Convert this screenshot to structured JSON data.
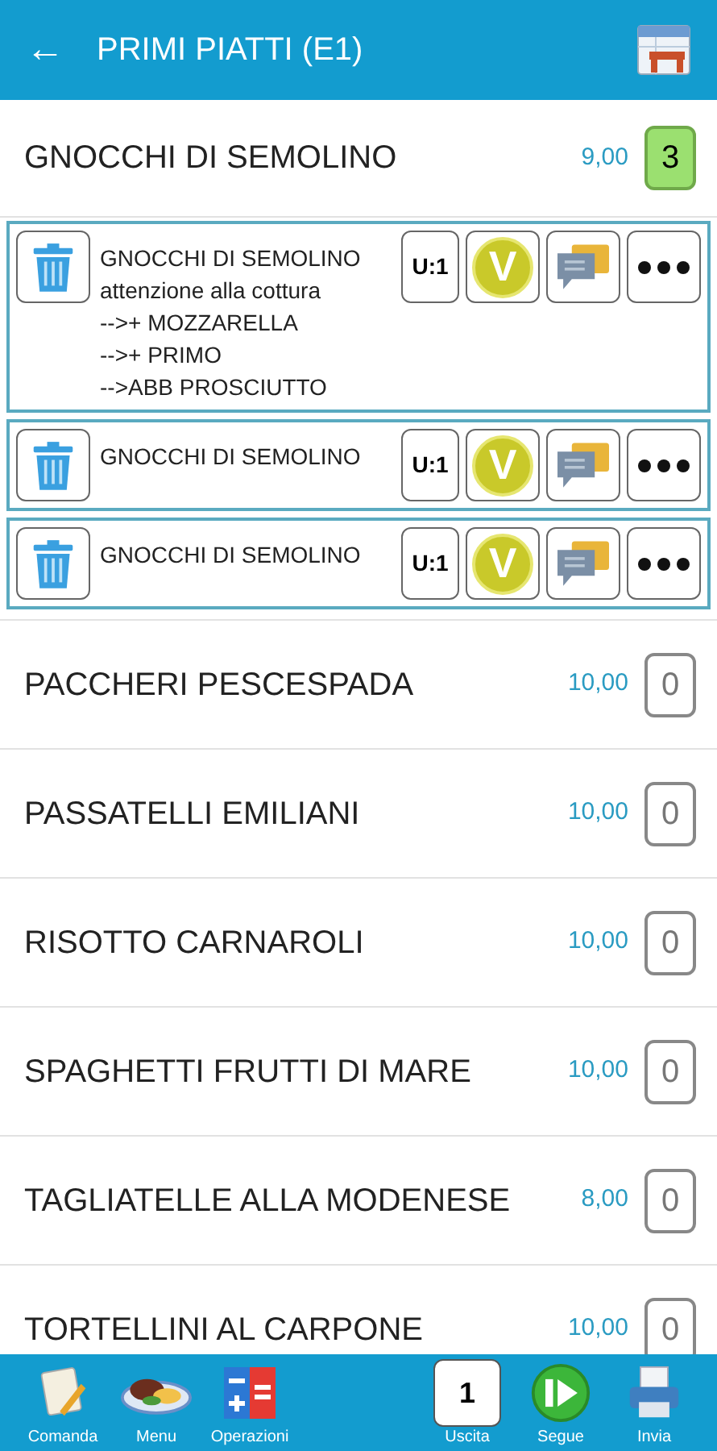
{
  "app_bar": {
    "back": "←",
    "title": "PRIMI PIATTI (E1)"
  },
  "expanded_item": {
    "name": "GNOCCHI DI SEMOLINO",
    "price": "9,00",
    "quantity": "3",
    "highlighted": true,
    "order_lines": [
      {
        "name": "GNOCCHI DI SEMOLINO",
        "notes": [
          "attenzione alla cottura",
          "-->+ MOZZARELLA",
          "-->+ PRIMO",
          "-->ABB PROSCIUTTO"
        ],
        "unit": "U:1",
        "mark": "V"
      },
      {
        "name": "GNOCCHI DI SEMOLINO",
        "unit": "U:1",
        "mark": "V"
      },
      {
        "name": "GNOCCHI DI SEMOLINO",
        "unit": "U:1",
        "mark": "V"
      }
    ]
  },
  "items": [
    {
      "name": "PACCHERI PESCESPADA",
      "price": "10,00",
      "quantity": "0",
      "highlighted": false
    },
    {
      "name": "PASSATELLI EMILIANI",
      "price": "10,00",
      "quantity": "0",
      "highlighted": false
    },
    {
      "name": "RISOTTO CARNAROLI",
      "price": "10,00",
      "quantity": "0",
      "highlighted": false
    },
    {
      "name": "SPAGHETTI FRUTTI DI MARE",
      "price": "10,00",
      "quantity": "0",
      "highlighted": false
    },
    {
      "name": "TAGLIATELLE ALLA MODENESE",
      "price": "8,00",
      "quantity": "0",
      "highlighted": false
    },
    {
      "name": "TORTELLINI AL CARPONE",
      "price": "10,00",
      "quantity": "0",
      "highlighted": false
    }
  ],
  "bottom_bar": [
    {
      "kind": "notepad",
      "label": "Comanda"
    },
    {
      "kind": "dish",
      "label": "Menu"
    },
    {
      "kind": "calculator",
      "label": "Operazioni"
    },
    {
      "kind": "counter",
      "label": "Uscita",
      "value": "1"
    },
    {
      "kind": "next",
      "label": "Segue"
    },
    {
      "kind": "printer",
      "label": "Invia"
    }
  ]
}
